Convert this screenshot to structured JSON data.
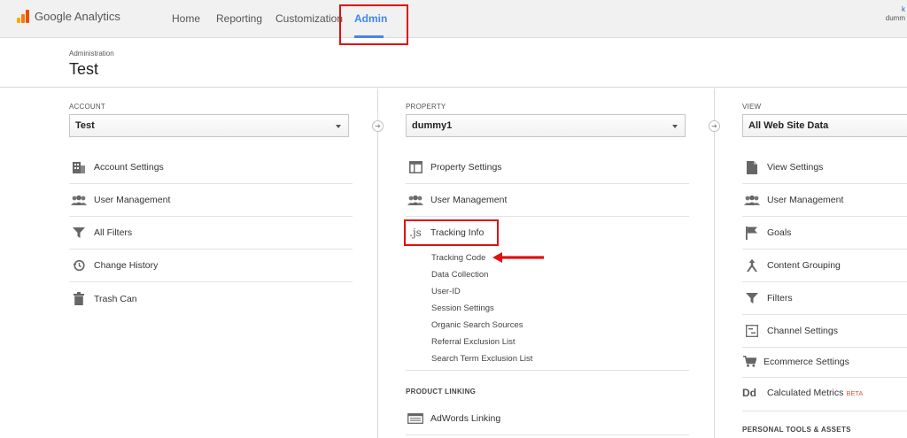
{
  "app": {
    "name": "Google Analytics"
  },
  "nav": {
    "home": "Home",
    "reporting": "Reporting",
    "customization": "Customization",
    "admin": "Admin"
  },
  "account_badge": {
    "user": "k",
    "property": "dumm"
  },
  "header": {
    "breadcrumb": "Administration",
    "title": "Test"
  },
  "account": {
    "label": "ACCOUNT",
    "selected": "Test",
    "items": [
      "Account Settings",
      "User Management",
      "All Filters",
      "Change History",
      "Trash Can"
    ]
  },
  "property": {
    "label": "PROPERTY",
    "selected": "dummy1",
    "items": [
      "Property Settings",
      "User Management",
      "Tracking Info"
    ],
    "tracking_sub": [
      "Tracking Code",
      "Data Collection",
      "User-ID",
      "Session Settings",
      "Organic Search Sources",
      "Referral Exclusion List",
      "Search Term Exclusion List"
    ],
    "product_linking_label": "PRODUCT LINKING",
    "adwords": "AdWords Linking"
  },
  "view": {
    "label": "VIEW",
    "selected": "All Web Site Data",
    "items": [
      "View Settings",
      "User Management",
      "Goals",
      "Content Grouping",
      "Filters",
      "Channel Settings",
      "Ecommerce Settings",
      "Calculated Metrics"
    ],
    "beta": "BETA",
    "personal_label": "PERSONAL TOOLS & ASSETS"
  },
  "colors": {
    "accent": "#4285f4",
    "highlight": "#e01010",
    "beta": "#e5523a"
  },
  "icons": {
    "account": [
      "building-icon",
      "users-icon",
      "filter-icon",
      "history-icon",
      "trash-icon"
    ],
    "property": [
      "window-icon",
      "users-icon",
      "js-icon"
    ],
    "view": [
      "document-icon",
      "users-icon",
      "flag-icon",
      "content-grouping-icon",
      "filter-icon",
      "channel-settings-icon",
      "cart-icon",
      "dd-icon"
    ]
  }
}
